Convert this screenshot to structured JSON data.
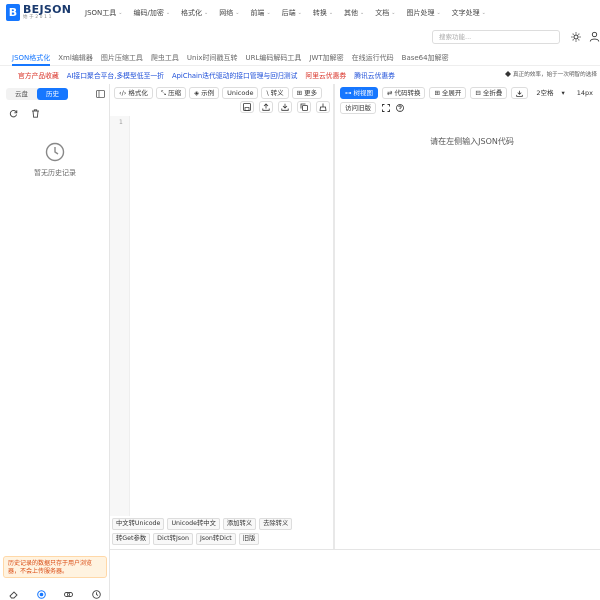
{
  "brand": {
    "name": "BEJSON",
    "sub": "始于2011",
    "mark": "B"
  },
  "nav": [
    {
      "label": "JSON工具"
    },
    {
      "label": "编码/加密"
    },
    {
      "label": "格式化"
    },
    {
      "label": "网络"
    },
    {
      "label": "前端"
    },
    {
      "label": "后端"
    },
    {
      "label": "转换"
    },
    {
      "label": "其他"
    },
    {
      "label": "文档"
    },
    {
      "label": "图片处理"
    },
    {
      "label": "文字处理"
    }
  ],
  "search": {
    "placeholder": "搜索功能..."
  },
  "tabs": [
    {
      "label": "JSON格式化",
      "active": true
    },
    {
      "label": "Xml编辑器"
    },
    {
      "label": "图片压缩工具"
    },
    {
      "label": "爬虫工具"
    },
    {
      "label": "Unix时间戳互转"
    },
    {
      "label": "URL编码解码工具"
    },
    {
      "label": "JWT加解密"
    },
    {
      "label": "在线运行代码"
    },
    {
      "label": "Base64加解密"
    }
  ],
  "promo": {
    "links": [
      {
        "label": "官方产品收藏",
        "color": "red"
      },
      {
        "label": "AI接口聚合平台,多模型低至一折",
        "color": "blue"
      },
      {
        "label": "ApiChain迭代驱动的接口管理与回归测试",
        "color": "blue"
      },
      {
        "label": "阿里云优惠券",
        "color": "red"
      },
      {
        "label": "腾讯云优惠券",
        "color": "blue"
      }
    ],
    "tip": "真正的效率，始于一次明智的选择"
  },
  "sidebar": {
    "seg": {
      "cloud": "云盘",
      "history": "历史"
    },
    "empty": "暂无历史记录",
    "notice": "历史记录的数据只存于用户浏览器，不会上传服务器。"
  },
  "editor": {
    "toolbar": {
      "format": "格式化",
      "compress": "压缩",
      "example": "示例",
      "unicode": "Unicode",
      "escape": "转义",
      "more": "更多"
    },
    "line": "1",
    "bottom_tools": [
      "中文转Unicode",
      "Unicode转中文",
      "添加转义",
      "去除转义",
      "转Get参数",
      "Dict转Json",
      "Json转Dict",
      "旧版"
    ]
  },
  "result": {
    "toolbar": {
      "tree": "树视图",
      "code_convert": "代码转换",
      "expand": "全展开",
      "collapse": "全折叠",
      "indent": "2空格",
      "font": "14px"
    },
    "history": "访问旧版",
    "placeholder": "请在左侧输入JSON代码"
  },
  "colors": {
    "accent": "#1677ff",
    "red": "#d93026",
    "blue": "#1d4ed8"
  }
}
